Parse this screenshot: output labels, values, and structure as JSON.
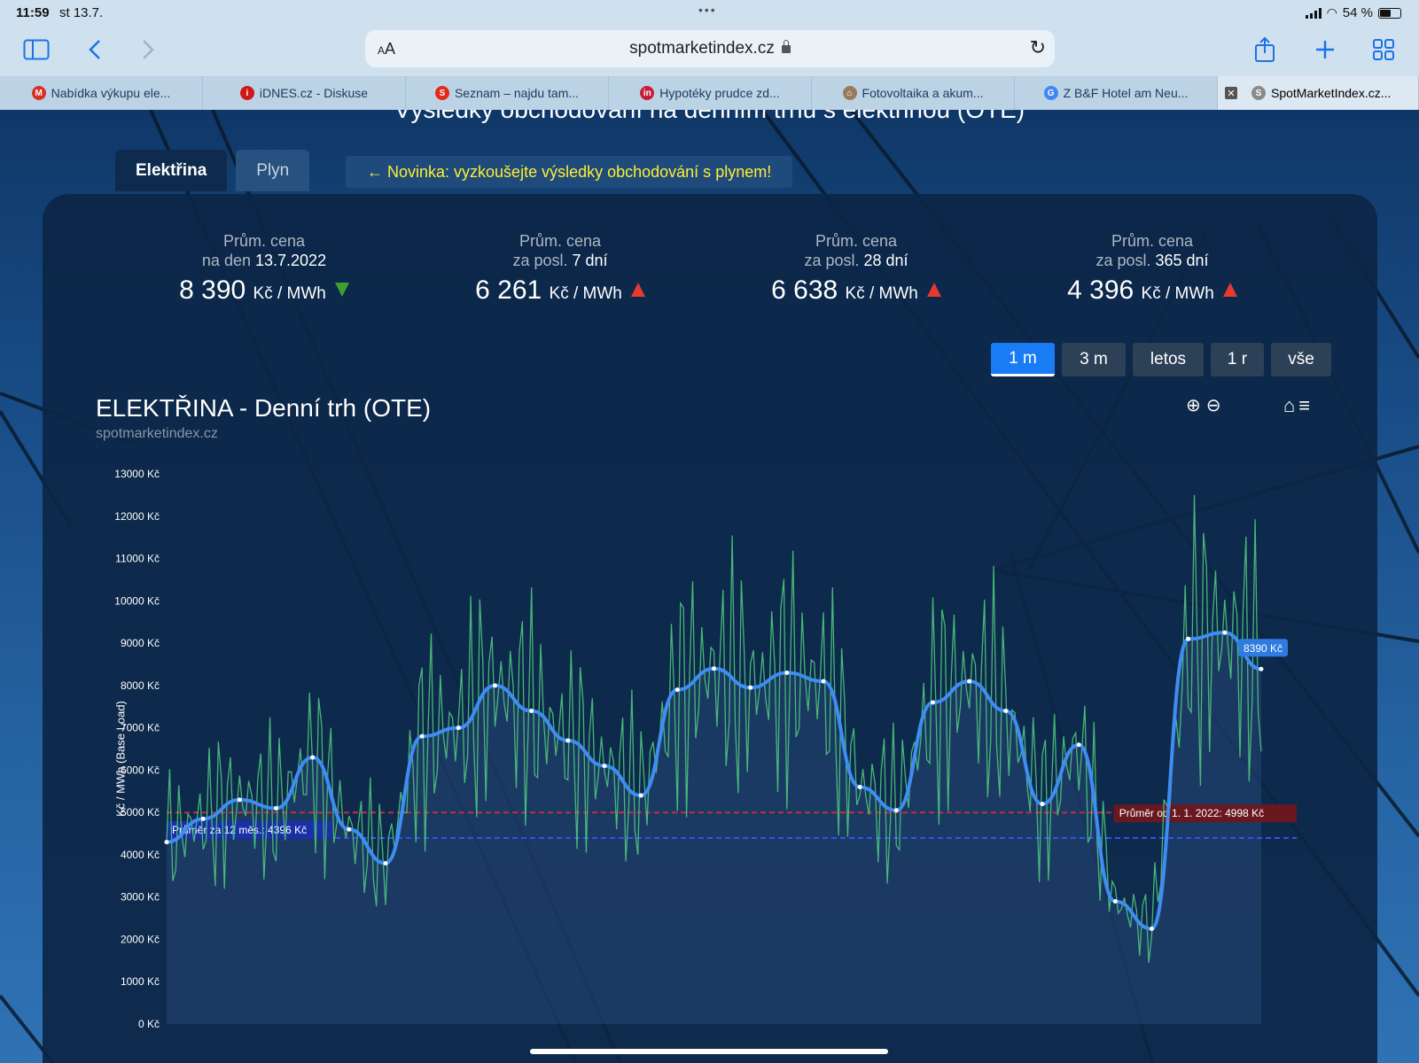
{
  "status": {
    "time": "11:59",
    "date": "st 13.7.",
    "battery": "54 %"
  },
  "browser": {
    "url": "spotmarketindex.cz",
    "aa_label": "AA",
    "tabs": [
      {
        "label": "Nabídka výkupu ele...",
        "icon": "gmail-icon",
        "color": "#d93025"
      },
      {
        "label": "iDNES.cz - Diskuse",
        "icon": "idnes-icon",
        "color": "#d01818"
      },
      {
        "label": "Seznam – najdu tam...",
        "icon": "seznam-icon",
        "color": "#e4291a"
      },
      {
        "label": "Hypotéky prudce zd...",
        "icon": "investiceweb-icon",
        "color": "#c81d3a"
      },
      {
        "label": "Fotovoltaika a akum...",
        "icon": "house-icon",
        "color": "#9a7a5a"
      },
      {
        "label": "Z B&F Hotel am Neu...",
        "icon": "google-icon",
        "color": "#4285f4"
      },
      {
        "label": "SpotMarketIndex.cz...",
        "icon": "spotmarket-icon",
        "color": "#8a8a8a"
      }
    ]
  },
  "page": {
    "heading": "Výsledky obchodování na denním trhu s elektřinou (OTE)",
    "tabs": [
      "Elektřina",
      "Plyn"
    ],
    "news": "← Novinka: vyzkoušejte výsledky obchodování s plynem!",
    "stats": [
      {
        "line1": "Prům. cena",
        "prefix": "na den",
        "bold": "13.7.2022",
        "value": "8 390",
        "unit": "Kč / MWh",
        "trend": "down"
      },
      {
        "line1": "Prům. cena",
        "prefix": "za posl.",
        "bold": "7 dní",
        "value": "6 261",
        "unit": "Kč / MWh",
        "trend": "up"
      },
      {
        "line1": "Prům. cena",
        "prefix": "za posl.",
        "bold": "28 dní",
        "value": "6 638",
        "unit": "Kč / MWh",
        "trend": "up"
      },
      {
        "line1": "Prům. cena",
        "prefix": "za posl.",
        "bold": "365 dní",
        "value": "4 396",
        "unit": "Kč / MWh",
        "trend": "up"
      }
    ],
    "ranges": [
      "1 m",
      "3 m",
      "letos",
      "1 r",
      "vše"
    ],
    "active_range": "1 m"
  },
  "chart_data": {
    "type": "line",
    "title": "ELEKTŘINA - Denní trh (OTE)",
    "subtitle": "spotmarketindex.cz",
    "ylabel": "Kč / MWh (Base Load)",
    "ylim": [
      0,
      13000
    ],
    "yticks": [
      "0 Kč",
      "1000 Kč",
      "2000 Kč",
      "3000 Kč",
      "4000 Kč",
      "5000 Kč",
      "6000 Kč",
      "7000 Kč",
      "8000 Kč",
      "9000 Kč",
      "10000 Kč",
      "11000 Kč",
      "12000 Kč",
      "13000 Kč"
    ],
    "daily_avg": [
      4300,
      4850,
      5300,
      5100,
      6300,
      4600,
      3800,
      6800,
      7000,
      8000,
      7400,
      6700,
      6100,
      5400,
      7900,
      8400,
      7950,
      8300,
      8100,
      5600,
      5050,
      7600,
      8100,
      7400,
      5200,
      6600,
      2900,
      2250,
      9100,
      9250,
      8390
    ],
    "hourly_range": [
      400,
      12500
    ],
    "reference_lines": [
      {
        "label": "Průměr za 12 měs.: 4396 Kč",
        "value": 4396,
        "color": "#2a56f0"
      },
      {
        "label": "Průměr od 1. 1. 2022: 4998 Kč",
        "value": 4998,
        "color": "#c0303a"
      }
    ],
    "last_point_label": "8390 Kč",
    "last_value": 8390,
    "colors": {
      "daily": "#3f8cf2",
      "hourly": "#4fc47e"
    }
  }
}
